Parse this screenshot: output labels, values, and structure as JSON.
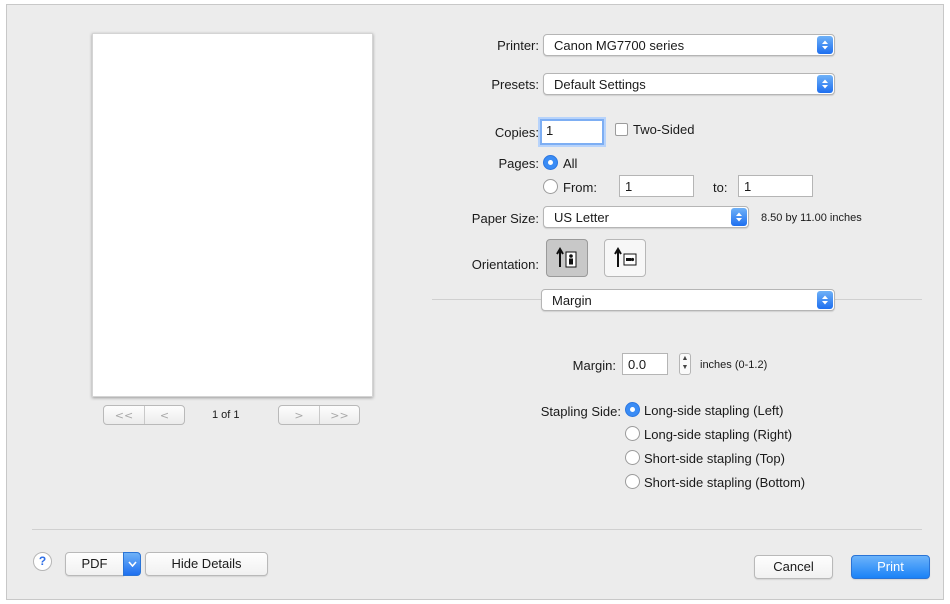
{
  "preview": {
    "page_counter": "1 of 1",
    "nav": {
      "first": "<<",
      "prev": "<",
      "next": ">",
      "last": ">>"
    }
  },
  "printer": {
    "label": "Printer:",
    "value": "Canon MG7700 series"
  },
  "presets": {
    "label": "Presets:",
    "value": "Default Settings"
  },
  "copies": {
    "label": "Copies:",
    "value": "1",
    "two_sided_label": "Two-Sided",
    "two_sided_checked": false
  },
  "pages": {
    "label": "Pages:",
    "all_label": "All",
    "from_label": "From:",
    "from_value": "1",
    "to_label": "to:",
    "to_value": "1",
    "selected": "All"
  },
  "paper_size": {
    "label": "Paper Size:",
    "value": "US Letter",
    "dimensions": "8.50 by 11.00 inches"
  },
  "orientation": {
    "label": "Orientation:",
    "selected": "portrait"
  },
  "section": {
    "value": "Margin"
  },
  "margin": {
    "label": "Margin:",
    "value": "0.0",
    "units": "inches (0-1.2)"
  },
  "stapling": {
    "label": "Stapling Side:",
    "options": [
      "Long-side stapling (Left)",
      "Long-side stapling (Right)",
      "Short-side stapling (Top)",
      "Short-side stapling (Bottom)"
    ],
    "selected_index": 0
  },
  "footer": {
    "help": "?",
    "pdf": "PDF",
    "hide_details": "Hide Details",
    "cancel": "Cancel",
    "print": "Print"
  },
  "colors": {
    "accent": "#1a82f7",
    "dialog_bg": "#ececec"
  }
}
